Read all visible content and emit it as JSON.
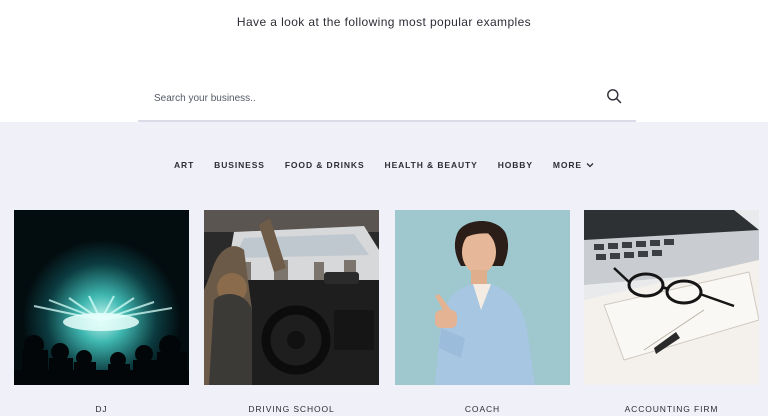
{
  "header": {
    "subtitle": "Have a look at the following most popular examples"
  },
  "search": {
    "placeholder": "Search your business..",
    "icon": "search-icon"
  },
  "categories": [
    {
      "label": "ART"
    },
    {
      "label": "BUSINESS"
    },
    {
      "label": "FOOD & DRINKS"
    },
    {
      "label": "HEALTH & BEAUTY"
    },
    {
      "label": "HOBBY"
    },
    {
      "label": "MORE",
      "icon": "chevron-down-icon"
    }
  ],
  "examples": [
    {
      "label": "DJ",
      "image": "concert-stage-lights"
    },
    {
      "label": "DRIVING SCHOOL",
      "image": "car-interior-steering-wheel"
    },
    {
      "label": "COACH",
      "image": "woman-in-blue-blazer-pointing"
    },
    {
      "label": "ACCOUNTING FIRM",
      "image": "laptop-glasses-notebook"
    }
  ],
  "colors": {
    "page_background": "#ffffff",
    "section_background": "#f0f1f8",
    "text": "#2d2d36"
  }
}
